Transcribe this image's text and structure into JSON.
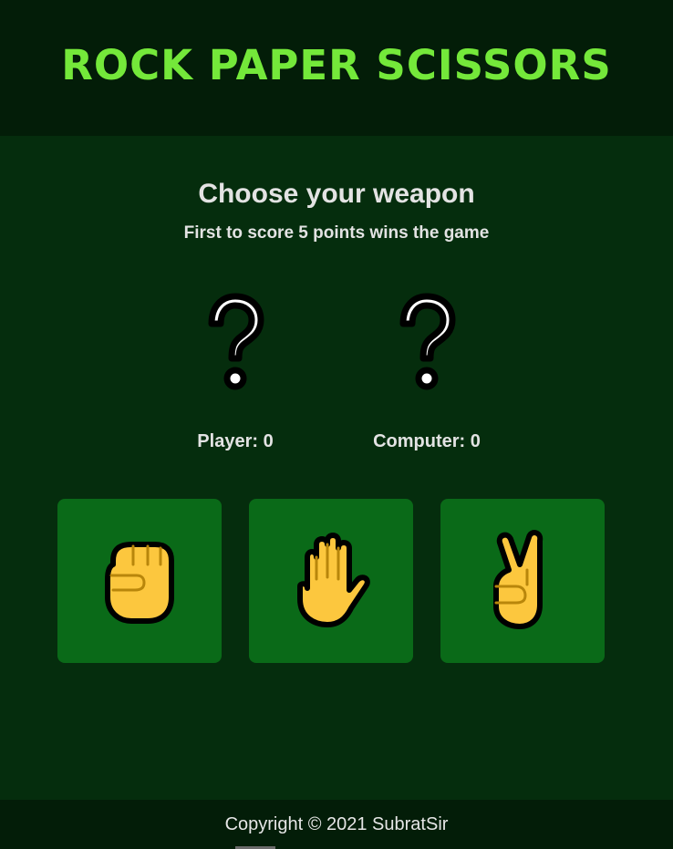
{
  "header": {
    "title": "ROCK PAPER SCISSORS"
  },
  "main": {
    "title": "Choose your weapon",
    "subtitle": "First to score 5 points wins the game",
    "player_score_label": "Player: 0",
    "computer_score_label": "Computer: 0",
    "player_choice_icon": "question-mark-icon",
    "computer_choice_icon": "question-mark-icon",
    "weapons": [
      {
        "name": "rock",
        "icon": "raised-fist-icon"
      },
      {
        "name": "paper",
        "icon": "raised-hand-icon"
      },
      {
        "name": "scissors",
        "icon": "victory-hand-icon"
      }
    ]
  },
  "footer": {
    "copyright": "Copyright © 2021 SubratSir"
  },
  "colors": {
    "header_bg": "#031d08",
    "main_bg": "#052d0d",
    "title_green": "#74e83a",
    "button_bg": "#0a6a18",
    "hand_yellow": "#fcc73e"
  }
}
